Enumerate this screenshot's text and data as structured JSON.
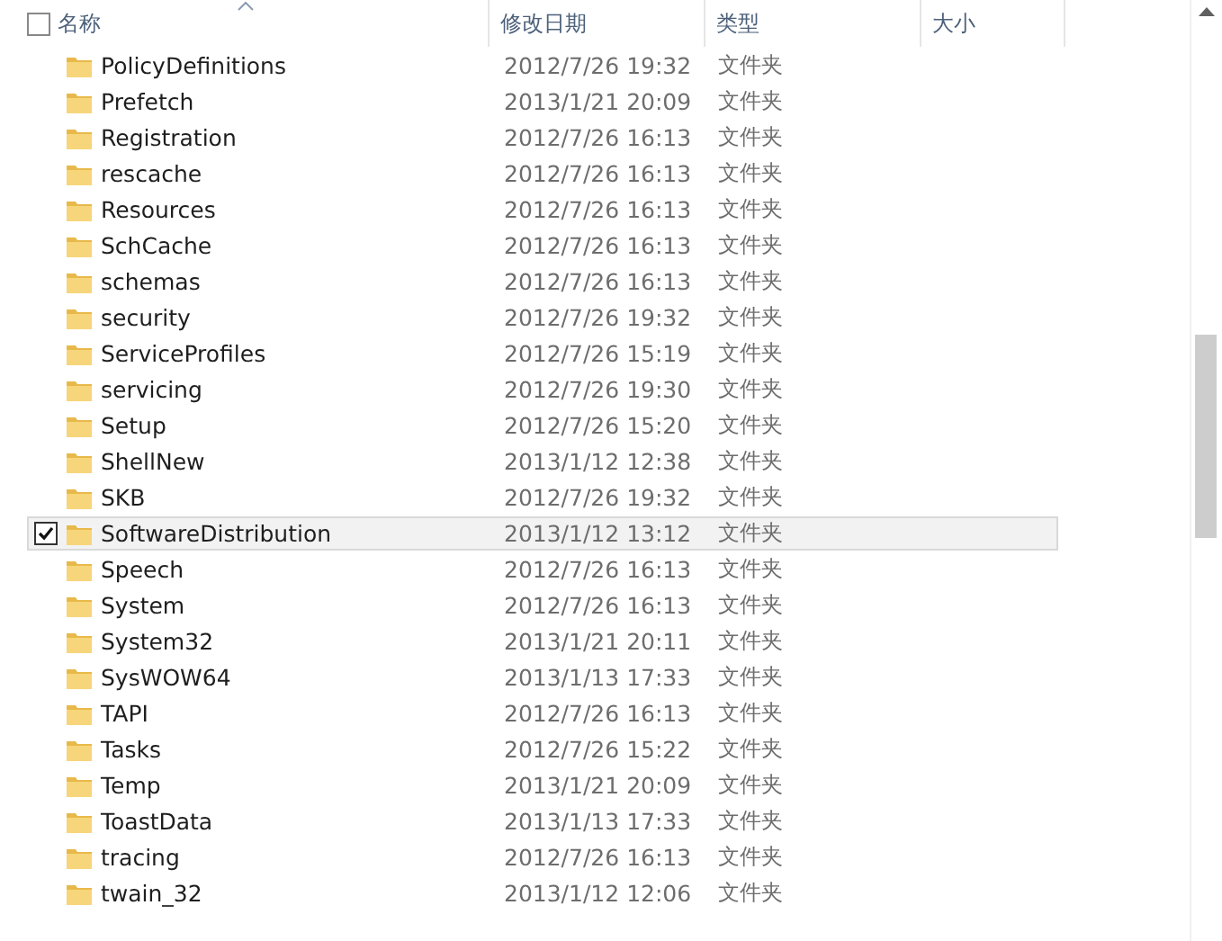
{
  "header": {
    "select_all_checked": false,
    "columns": [
      {
        "label": "名称",
        "sorted": true
      },
      {
        "label": "修改日期",
        "sorted": false
      },
      {
        "label": "类型",
        "sorted": false
      },
      {
        "label": "大小",
        "sorted": false
      }
    ]
  },
  "rows": [
    {
      "name": "PolicyDefinitions",
      "date": "2012/7/26 19:32",
      "type": "文件夹",
      "selected": false
    },
    {
      "name": "Prefetch",
      "date": "2013/1/21 20:09",
      "type": "文件夹",
      "selected": false
    },
    {
      "name": "Registration",
      "date": "2012/7/26 16:13",
      "type": "文件夹",
      "selected": false
    },
    {
      "name": "rescache",
      "date": "2012/7/26 16:13",
      "type": "文件夹",
      "selected": false
    },
    {
      "name": "Resources",
      "date": "2012/7/26 16:13",
      "type": "文件夹",
      "selected": false
    },
    {
      "name": "SchCache",
      "date": "2012/7/26 16:13",
      "type": "文件夹",
      "selected": false
    },
    {
      "name": "schemas",
      "date": "2012/7/26 16:13",
      "type": "文件夹",
      "selected": false
    },
    {
      "name": "security",
      "date": "2012/7/26 19:32",
      "type": "文件夹",
      "selected": false
    },
    {
      "name": "ServiceProfiles",
      "date": "2012/7/26 15:19",
      "type": "文件夹",
      "selected": false
    },
    {
      "name": "servicing",
      "date": "2012/7/26 19:30",
      "type": "文件夹",
      "selected": false
    },
    {
      "name": "Setup",
      "date": "2012/7/26 15:20",
      "type": "文件夹",
      "selected": false
    },
    {
      "name": "ShellNew",
      "date": "2013/1/12 12:38",
      "type": "文件夹",
      "selected": false
    },
    {
      "name": "SKB",
      "date": "2012/7/26 19:32",
      "type": "文件夹",
      "selected": false
    },
    {
      "name": "SoftwareDistribution",
      "date": "2013/1/12 13:12",
      "type": "文件夹",
      "selected": true
    },
    {
      "name": "Speech",
      "date": "2012/7/26 16:13",
      "type": "文件夹",
      "selected": false
    },
    {
      "name": "System",
      "date": "2012/7/26 16:13",
      "type": "文件夹",
      "selected": false
    },
    {
      "name": "System32",
      "date": "2013/1/21 20:11",
      "type": "文件夹",
      "selected": false
    },
    {
      "name": "SysWOW64",
      "date": "2013/1/13 17:33",
      "type": "文件夹",
      "selected": false
    },
    {
      "name": "TAPI",
      "date": "2012/7/26 16:13",
      "type": "文件夹",
      "selected": false
    },
    {
      "name": "Tasks",
      "date": "2012/7/26 15:22",
      "type": "文件夹",
      "selected": false
    },
    {
      "name": "Temp",
      "date": "2013/1/21 20:09",
      "type": "文件夹",
      "selected": false
    },
    {
      "name": "ToastData",
      "date": "2013/1/13 17:33",
      "type": "文件夹",
      "selected": false
    },
    {
      "name": "tracing",
      "date": "2012/7/26 16:13",
      "type": "文件夹",
      "selected": false
    },
    {
      "name": "twain_32",
      "date": "2013/1/12 12:06",
      "type": "文件夹",
      "selected": false
    }
  ]
}
